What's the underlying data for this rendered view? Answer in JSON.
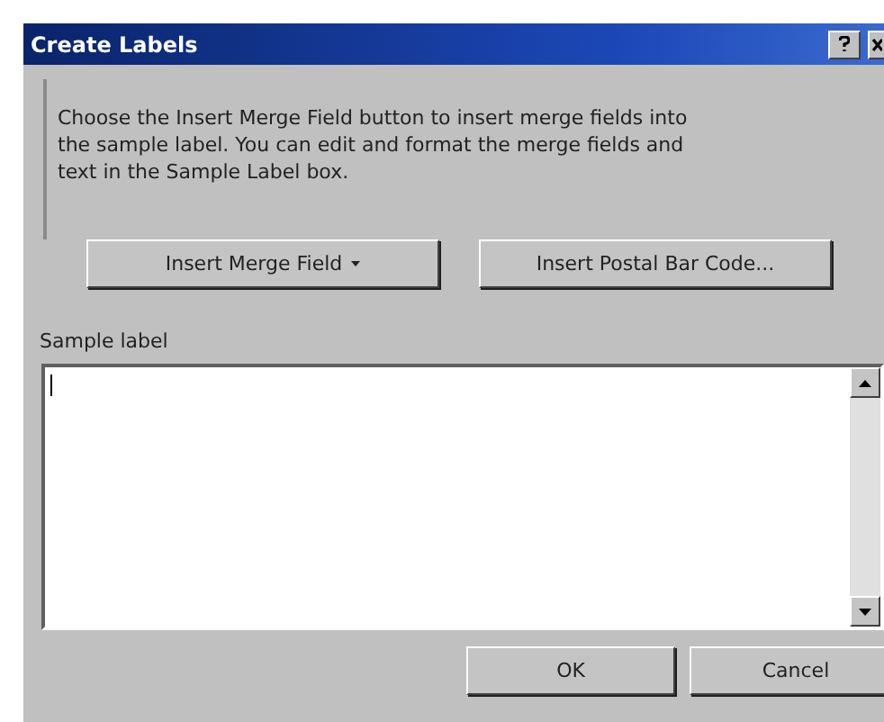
{
  "window": {
    "title": "Create Labels"
  },
  "instructions": "Choose the Insert Merge Field button to insert merge fields into the sample label.  You can edit and format the merge fields and text in the Sample Label box.",
  "insert_buttons": [
    {
      "label": "Insert Merge Field",
      "kind": "dropdown"
    },
    {
      "label": "Insert Postal Bar Code...",
      "kind": "plain"
    }
  ],
  "sample_label": {
    "label": "Sample label"
  },
  "footer_buttons": [
    "OK",
    "Cancel"
  ]
}
